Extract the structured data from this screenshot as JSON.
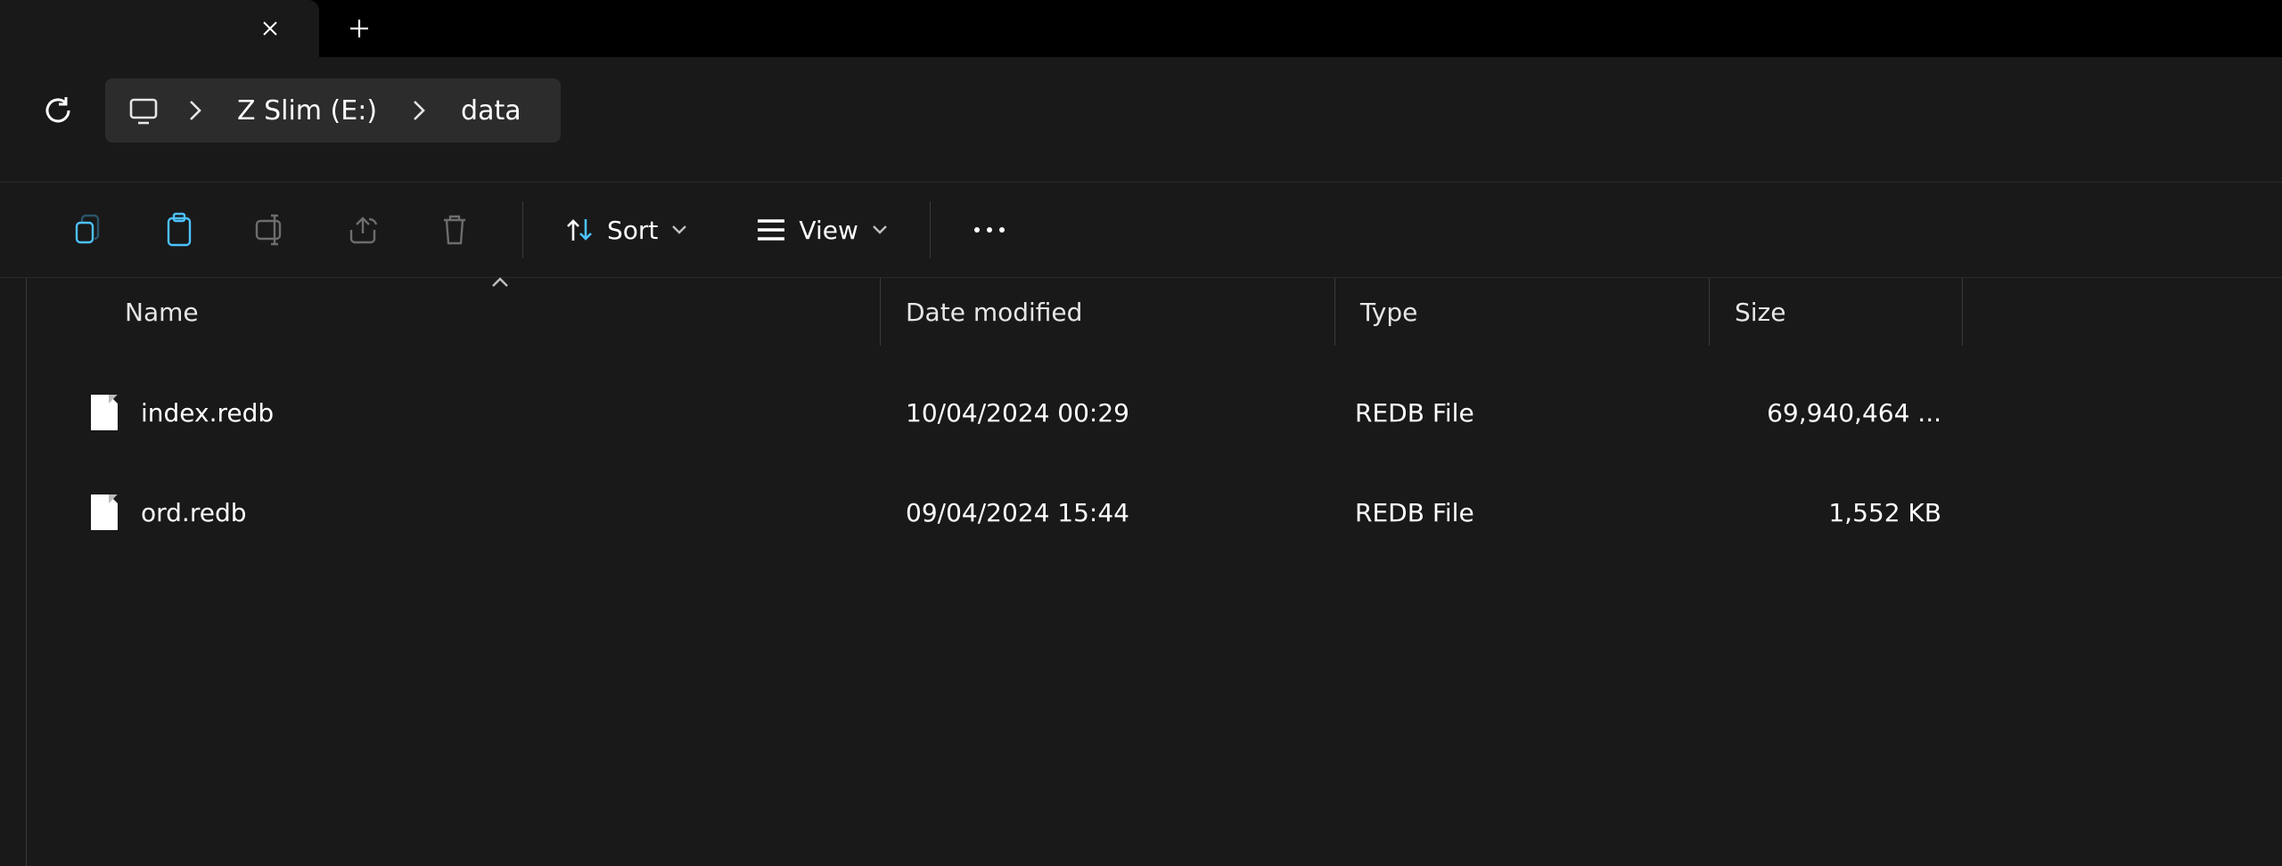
{
  "breadcrumb": {
    "drive": "Z Slim (E:)",
    "folder": "data"
  },
  "toolbar": {
    "sort_label": "Sort",
    "view_label": "View"
  },
  "columns": {
    "name": "Name",
    "date": "Date modified",
    "type": "Type",
    "size": "Size"
  },
  "files": [
    {
      "name": "index.redb",
      "date": "10/04/2024 00:29",
      "type": "REDB File",
      "size": "69,940,464 ..."
    },
    {
      "name": "ord.redb",
      "date": "09/04/2024 15:44",
      "type": "REDB File",
      "size": "1,552 KB"
    }
  ]
}
